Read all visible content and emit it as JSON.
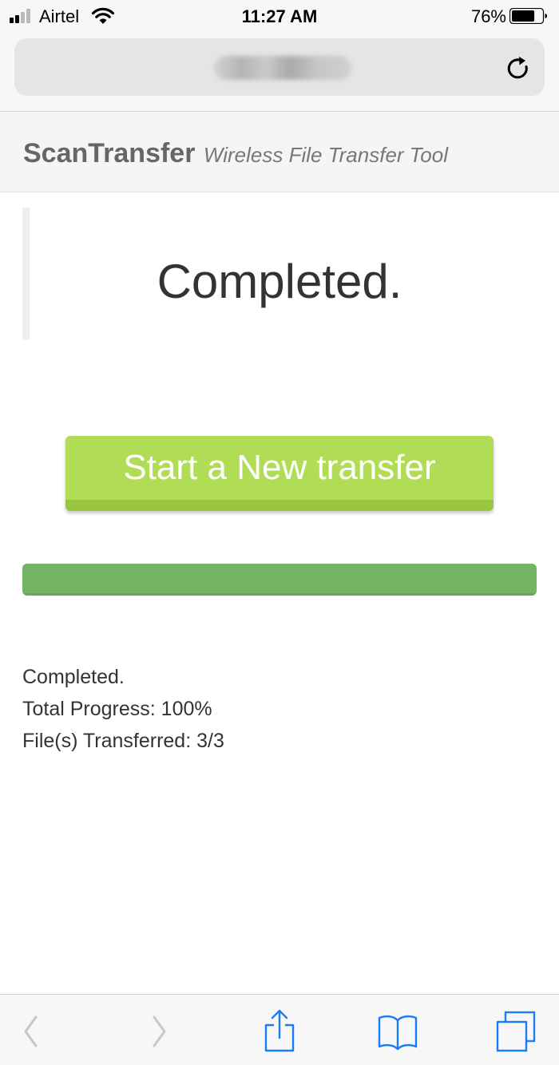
{
  "status_bar": {
    "carrier": "Airtel",
    "time": "11:27 AM",
    "battery_percent": "76%",
    "battery_level": 0.76,
    "signal_bars": 2,
    "signal_bars_total": 4,
    "icons": [
      "signal-icon",
      "wifi-icon",
      "battery-icon"
    ]
  },
  "browser": {
    "address_redacted": true,
    "reload_icon": "reload-icon"
  },
  "app": {
    "name": "ScanTransfer",
    "tagline": "Wireless File Transfer Tool"
  },
  "main": {
    "status_heading": "Completed.",
    "new_transfer_button": "Start a New transfer",
    "progress": 1.0,
    "details": {
      "status_line": "Completed.",
      "total_progress": "Total Progress: 100%",
      "files_transferred": "File(s) Transferred: 3/3"
    }
  },
  "toolbar": {
    "buttons": [
      "back-icon",
      "forward-icon",
      "share-icon",
      "bookmarks-icon",
      "tabs-icon"
    ],
    "back_enabled": false,
    "forward_enabled": false
  },
  "colors": {
    "button_green": "#b1dc56",
    "button_green_edge": "#9ac540",
    "progress_green": "#74b465",
    "ios_blue": "#1a7cf6",
    "disabled_gray": "#c7c7cc"
  }
}
